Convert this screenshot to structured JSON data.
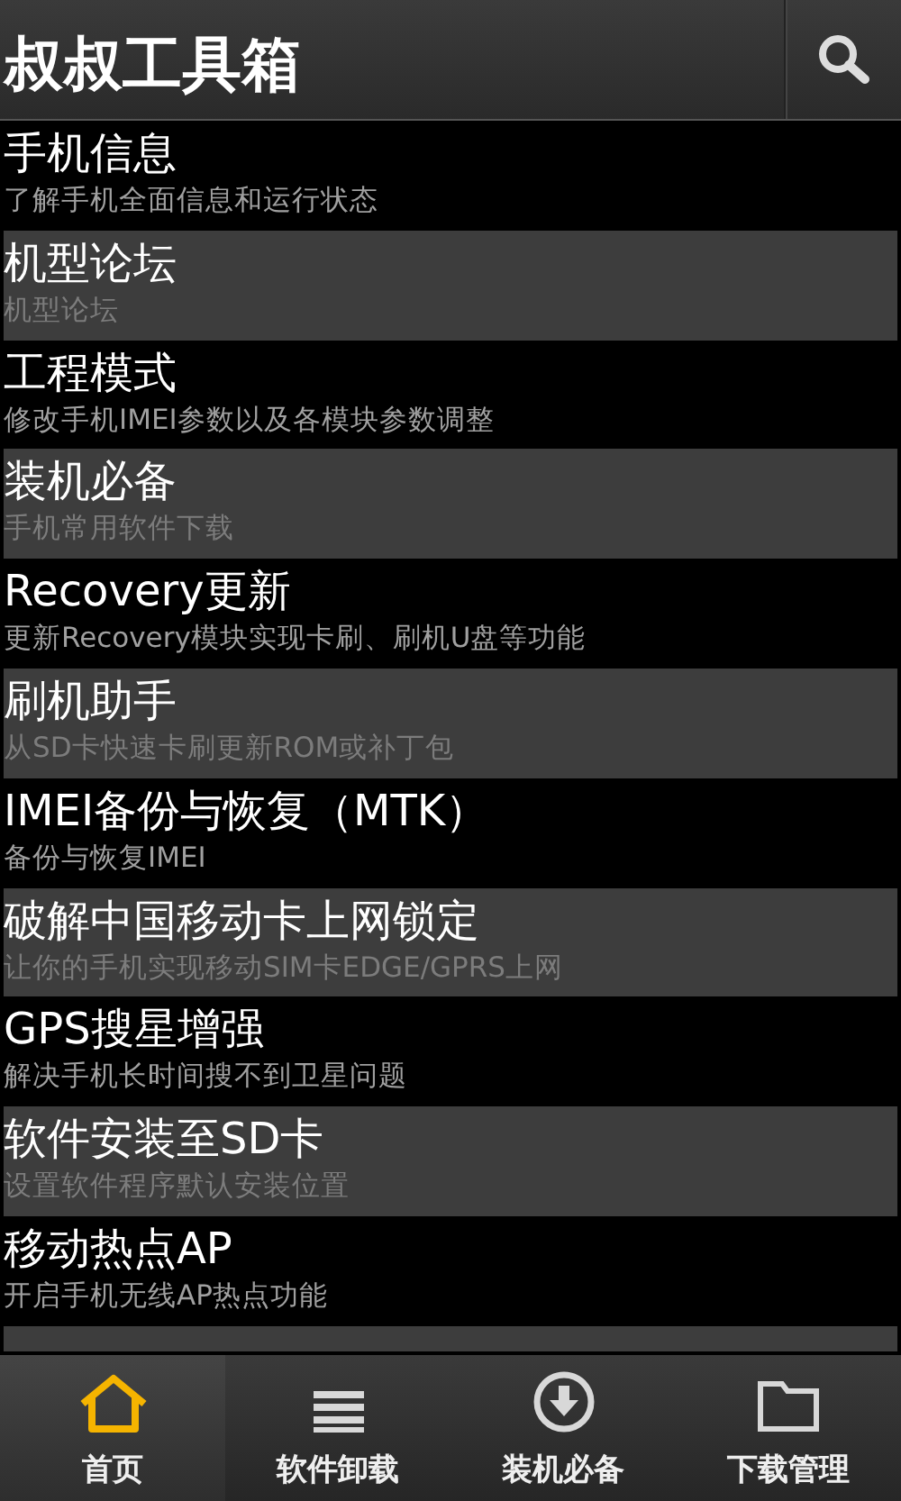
{
  "app_bar": {
    "title": "叔叔工具箱"
  },
  "items": [
    {
      "title": "手机信息",
      "subtitle": "了解手机全面信息和运行状态"
    },
    {
      "title": "机型论坛",
      "subtitle": "机型论坛"
    },
    {
      "title": "工程模式",
      "subtitle": "修改手机IMEI参数以及各模块参数调整"
    },
    {
      "title": "装机必备",
      "subtitle": "手机常用软件下载"
    },
    {
      "title": "Recovery更新",
      "subtitle": "更新Recovery模块实现卡刷、刷机U盘等功能"
    },
    {
      "title": "刷机助手",
      "subtitle": "从SD卡快速卡刷更新ROM或补丁包"
    },
    {
      "title": "IMEI备份与恢复（MTK）",
      "subtitle": "备份与恢复IMEI"
    },
    {
      "title": "破解中国移动卡上网锁定",
      "subtitle": "让你的手机实现移动SIM卡EDGE/GPRS上网"
    },
    {
      "title": "GPS搜星增强",
      "subtitle": "解决手机长时间搜不到卫星问题"
    },
    {
      "title": "软件安装至SD卡",
      "subtitle": "设置软件程序默认安装位置"
    },
    {
      "title": "移动热点AP",
      "subtitle": "开启手机无线AP热点功能"
    }
  ],
  "bottom_nav": [
    {
      "label": "首页",
      "kind": "home",
      "selected": true
    },
    {
      "label": "软件卸载",
      "kind": "list",
      "selected": false
    },
    {
      "label": "装机必备",
      "kind": "download",
      "selected": false
    },
    {
      "label": "下载管理",
      "kind": "folder",
      "selected": false
    }
  ]
}
